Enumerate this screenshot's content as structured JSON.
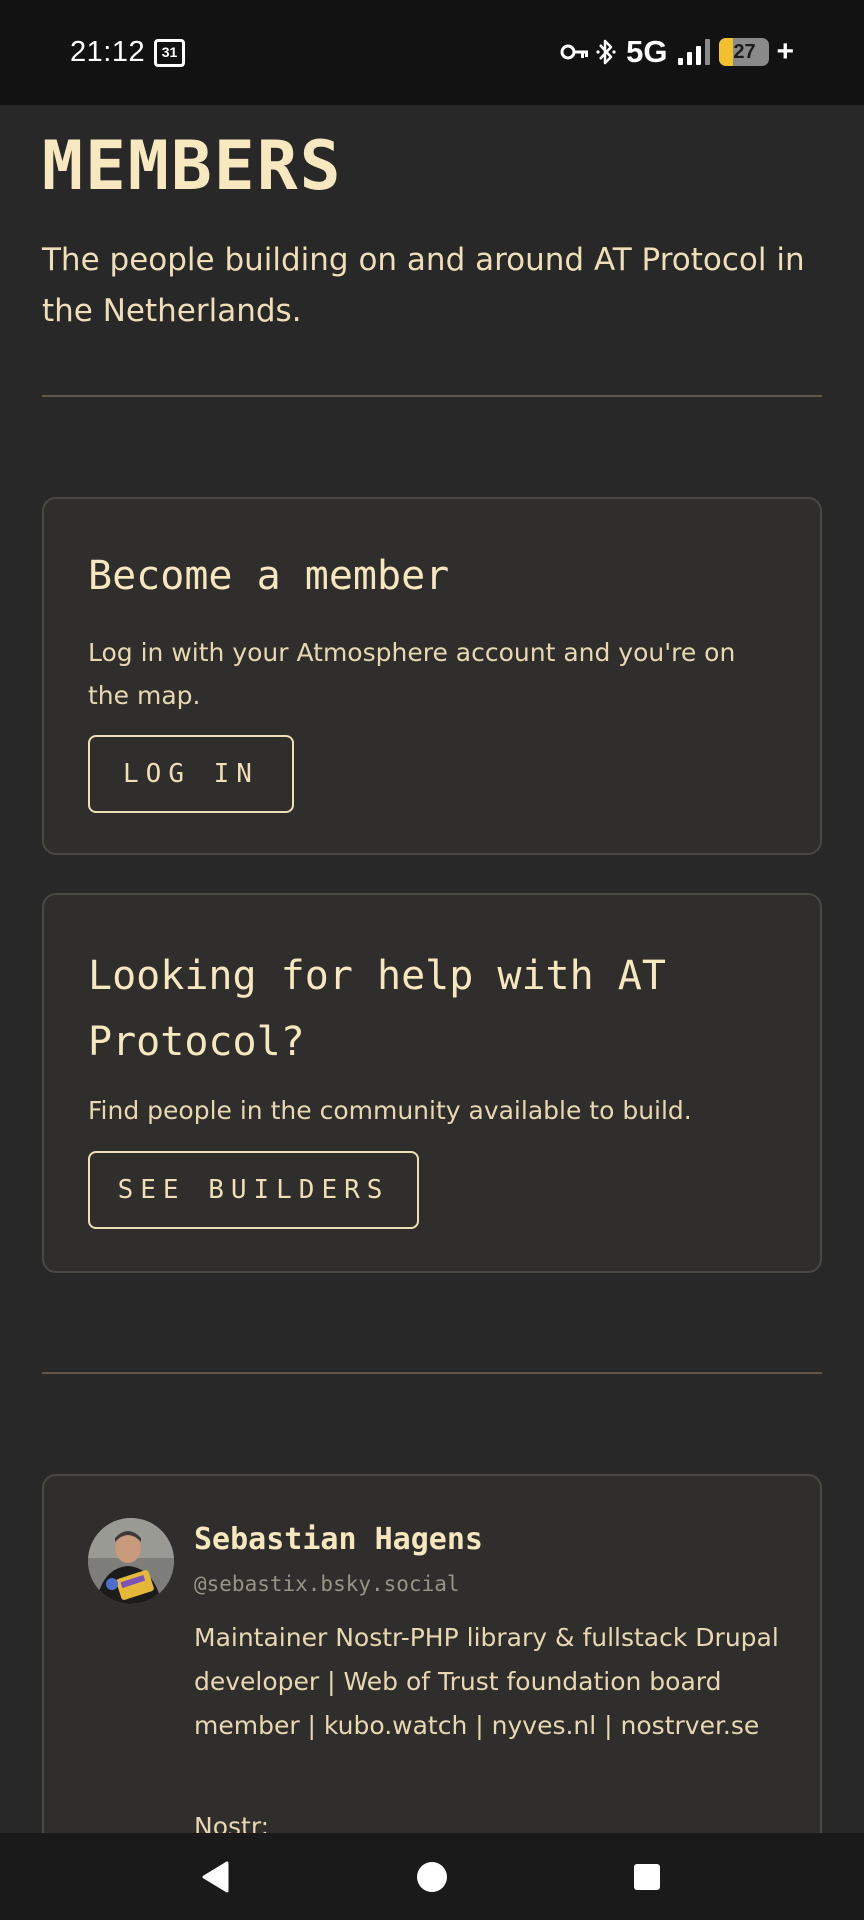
{
  "status_bar": {
    "time": "21:12",
    "calendar_day": "31",
    "network": "5G",
    "battery_level": "27",
    "battery_fraction": 0.27,
    "charging": "+"
  },
  "page": {
    "title": "MEMBERS",
    "subtitle": "The people building on and around AT Protocol in the Netherlands."
  },
  "become_member_card": {
    "heading": "Become a member",
    "text": "Log in with your Atmosphere account and you're on the map.",
    "button_label": "LOG IN"
  },
  "help_card": {
    "heading": "Looking for help with AT Protocol?",
    "text": "Find people in the community available to build.",
    "button_label": "SEE BUILDERS"
  },
  "members": [
    {
      "name": "Sebastian Hagens",
      "handle": "@sebastix.bsky.social",
      "bio": "Maintainer Nostr-PHP library & fullstack Drupal developer | Web of Trust foundation board member | kubo.watch | nyves.nl | nostrver.se",
      "bio_extra": "Nostr:"
    }
  ],
  "nav": {
    "back_icon": "back-triangle-icon",
    "home_icon": "home-circle-icon",
    "recents_icon": "recents-square-icon"
  },
  "colors": {
    "background": "#282828",
    "card": "#2f2e2d",
    "text": "#f5e6bf",
    "status_bar": "#121212",
    "battery_accent": "#f2c02a"
  }
}
